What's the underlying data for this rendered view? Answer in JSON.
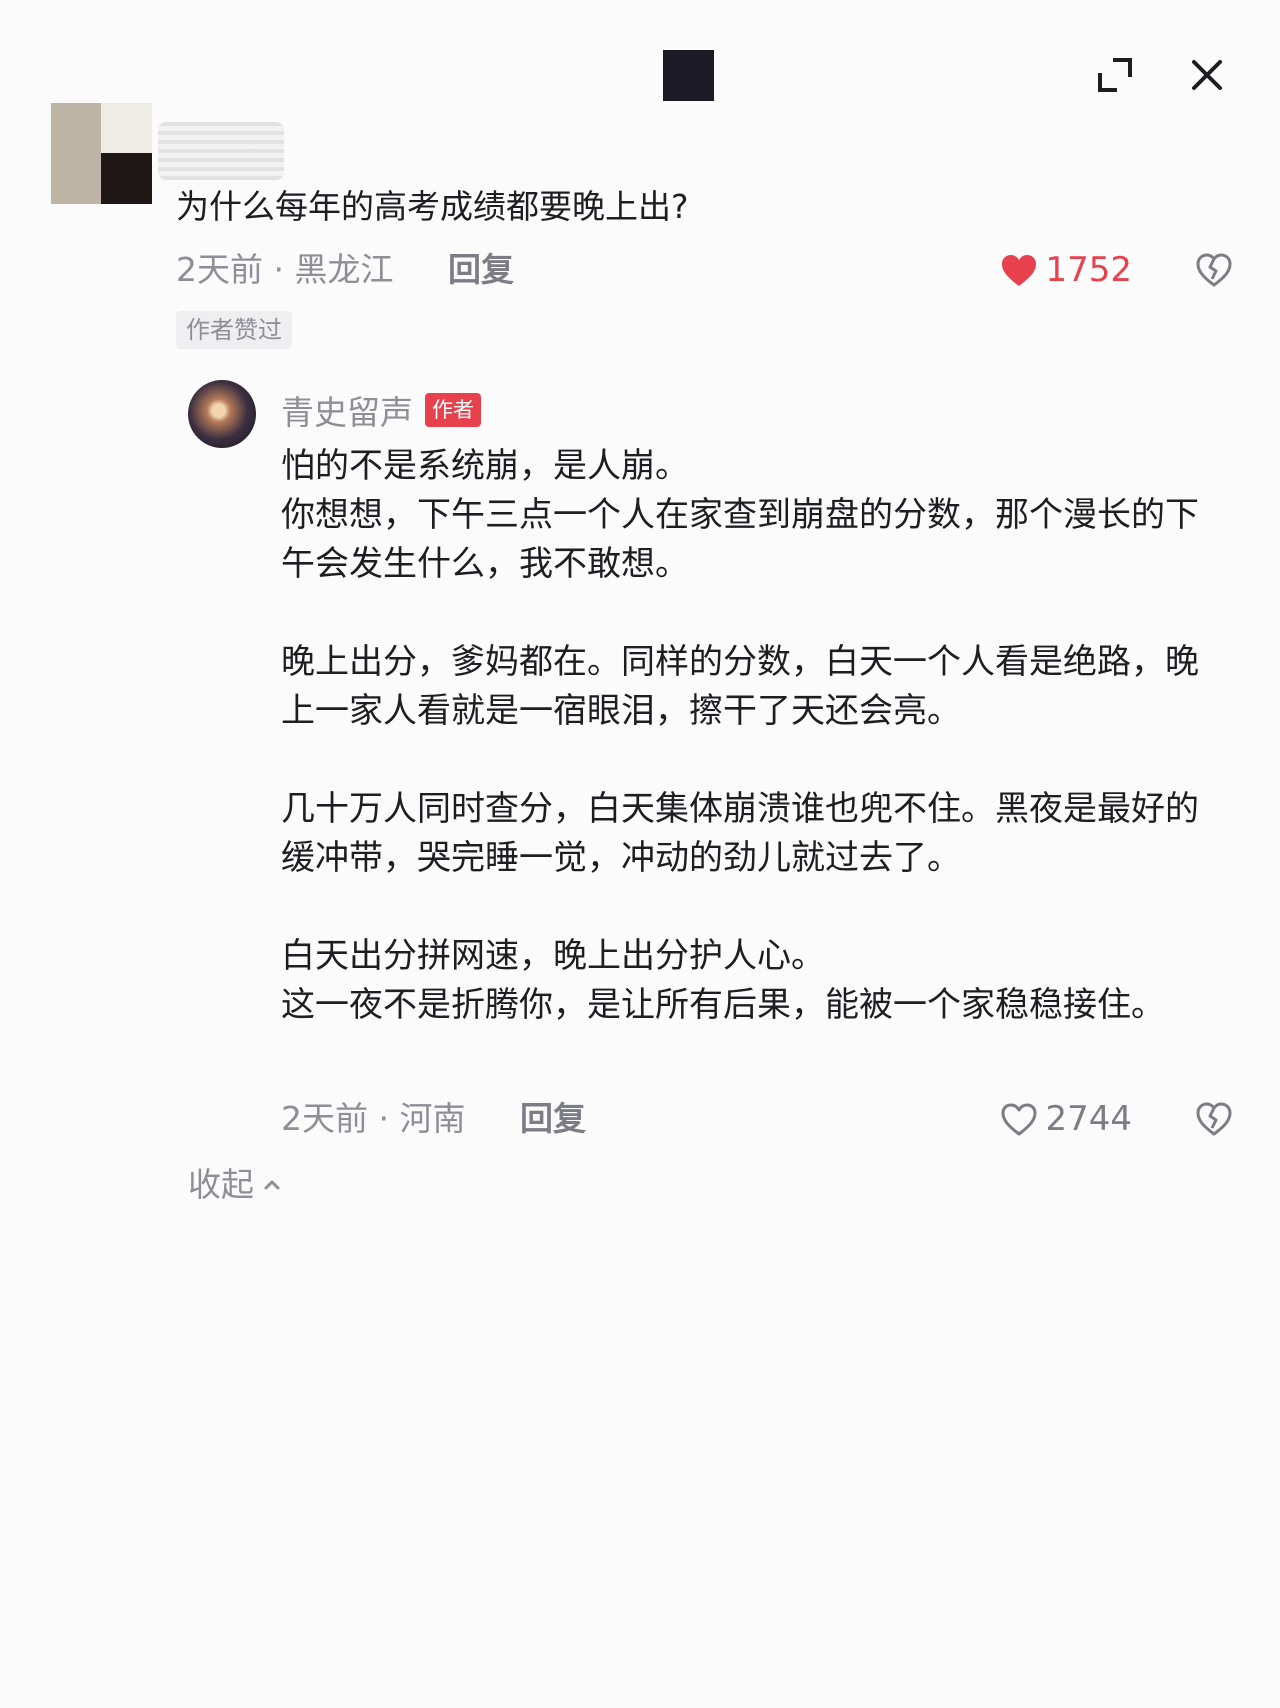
{
  "comment": {
    "text": "为什么每年的高考成绩都要晚上出?",
    "meta": "2天前 · 黑龙江",
    "reply_label": "回复",
    "likes": "1752",
    "liked": true,
    "author_liked_badge": "作者赞过"
  },
  "reply": {
    "author": "青史留声",
    "author_badge": "作者",
    "paragraphs": [
      "怕的不是系统崩，是人崩。\n你想想，下午三点一个人在家查到崩盘的分数，那个漫长的下午会发生什么，我不敢想。",
      "晚上出分，爹妈都在。同样的分数，白天一个人看是绝路，晚上一家人看就是一宿眼泪，擦干了天还会亮。",
      "几十万人同时查分，白天集体崩溃谁也兜不住。黑夜是最好的缓冲带，哭完睡一觉，冲动的劲儿就过去了。",
      "白天出分拼网速，晚上出分护人心。\n这一夜不是折腾你，是让所有后果，能被一个家稳稳接住。"
    ],
    "meta": "2天前 · 河南",
    "reply_label": "回复",
    "likes": "2744",
    "liked": false
  },
  "collapse_label": "收起",
  "colors": {
    "accent_red": "#e8414e",
    "text_primary": "#1e1e22",
    "text_secondary": "#8e8e96"
  },
  "icons": {
    "drag": "drag-handle-icon",
    "expand": "expand-icon",
    "close": "close-icon",
    "like_filled": "heart-filled-icon",
    "like_outline": "heart-outline-icon",
    "dislike": "broken-heart-icon",
    "collapse": "chevron-up-icon"
  }
}
